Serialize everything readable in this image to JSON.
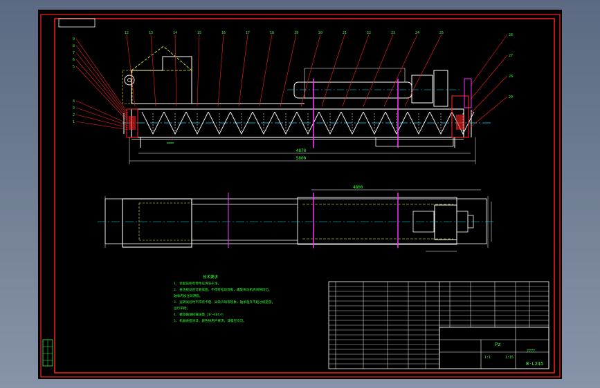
{
  "colors": {
    "background": "#000000",
    "frame": "#ff2020",
    "outline": "#ffffff",
    "centerline": "#00e5ff",
    "hidden": "#ffff33",
    "text": "#33ff33",
    "leader": "#ff2020",
    "accent": "#ff33ff"
  },
  "balloons_left": [
    "9",
    "8",
    "7",
    "6",
    "5",
    "4",
    "3",
    "2",
    "1"
  ],
  "balloons_top": [
    "12",
    "13",
    "14",
    "15",
    "16",
    "17",
    "18",
    "19",
    "20",
    "21",
    "22",
    "23",
    "24",
    "25"
  ],
  "balloons_right": [
    "26",
    "27",
    "28",
    "29"
  ],
  "dims": {
    "overall": "5800",
    "inner": "4870",
    "plan_top": "4800"
  },
  "notes": {
    "heading": "技术要求",
    "lines": [
      "1. 装配前所有零件应清洗干净。",
      "2. 各连接处应可靠紧固，不得有松动现象，螺旋体与机壳间隙均匀。",
      "   轴承内加注润滑脂。",
      "3. 运转试验时不得有卡阻、异常声响等现象，轴承温升不超过规定值，",
      "   运行平稳。",
      "4. 螺旋输送机输送量  20～40t/h",
      "5. 机器表面涂漆，颜色按用户要求，漆膜应均匀。"
    ]
  },
  "title_block": {
    "company": "Pz",
    "drawing_no": "B-L245",
    "scale": "1:1",
    "sheet": "1:15",
    "name": "7777"
  },
  "bom_rows": 18
}
